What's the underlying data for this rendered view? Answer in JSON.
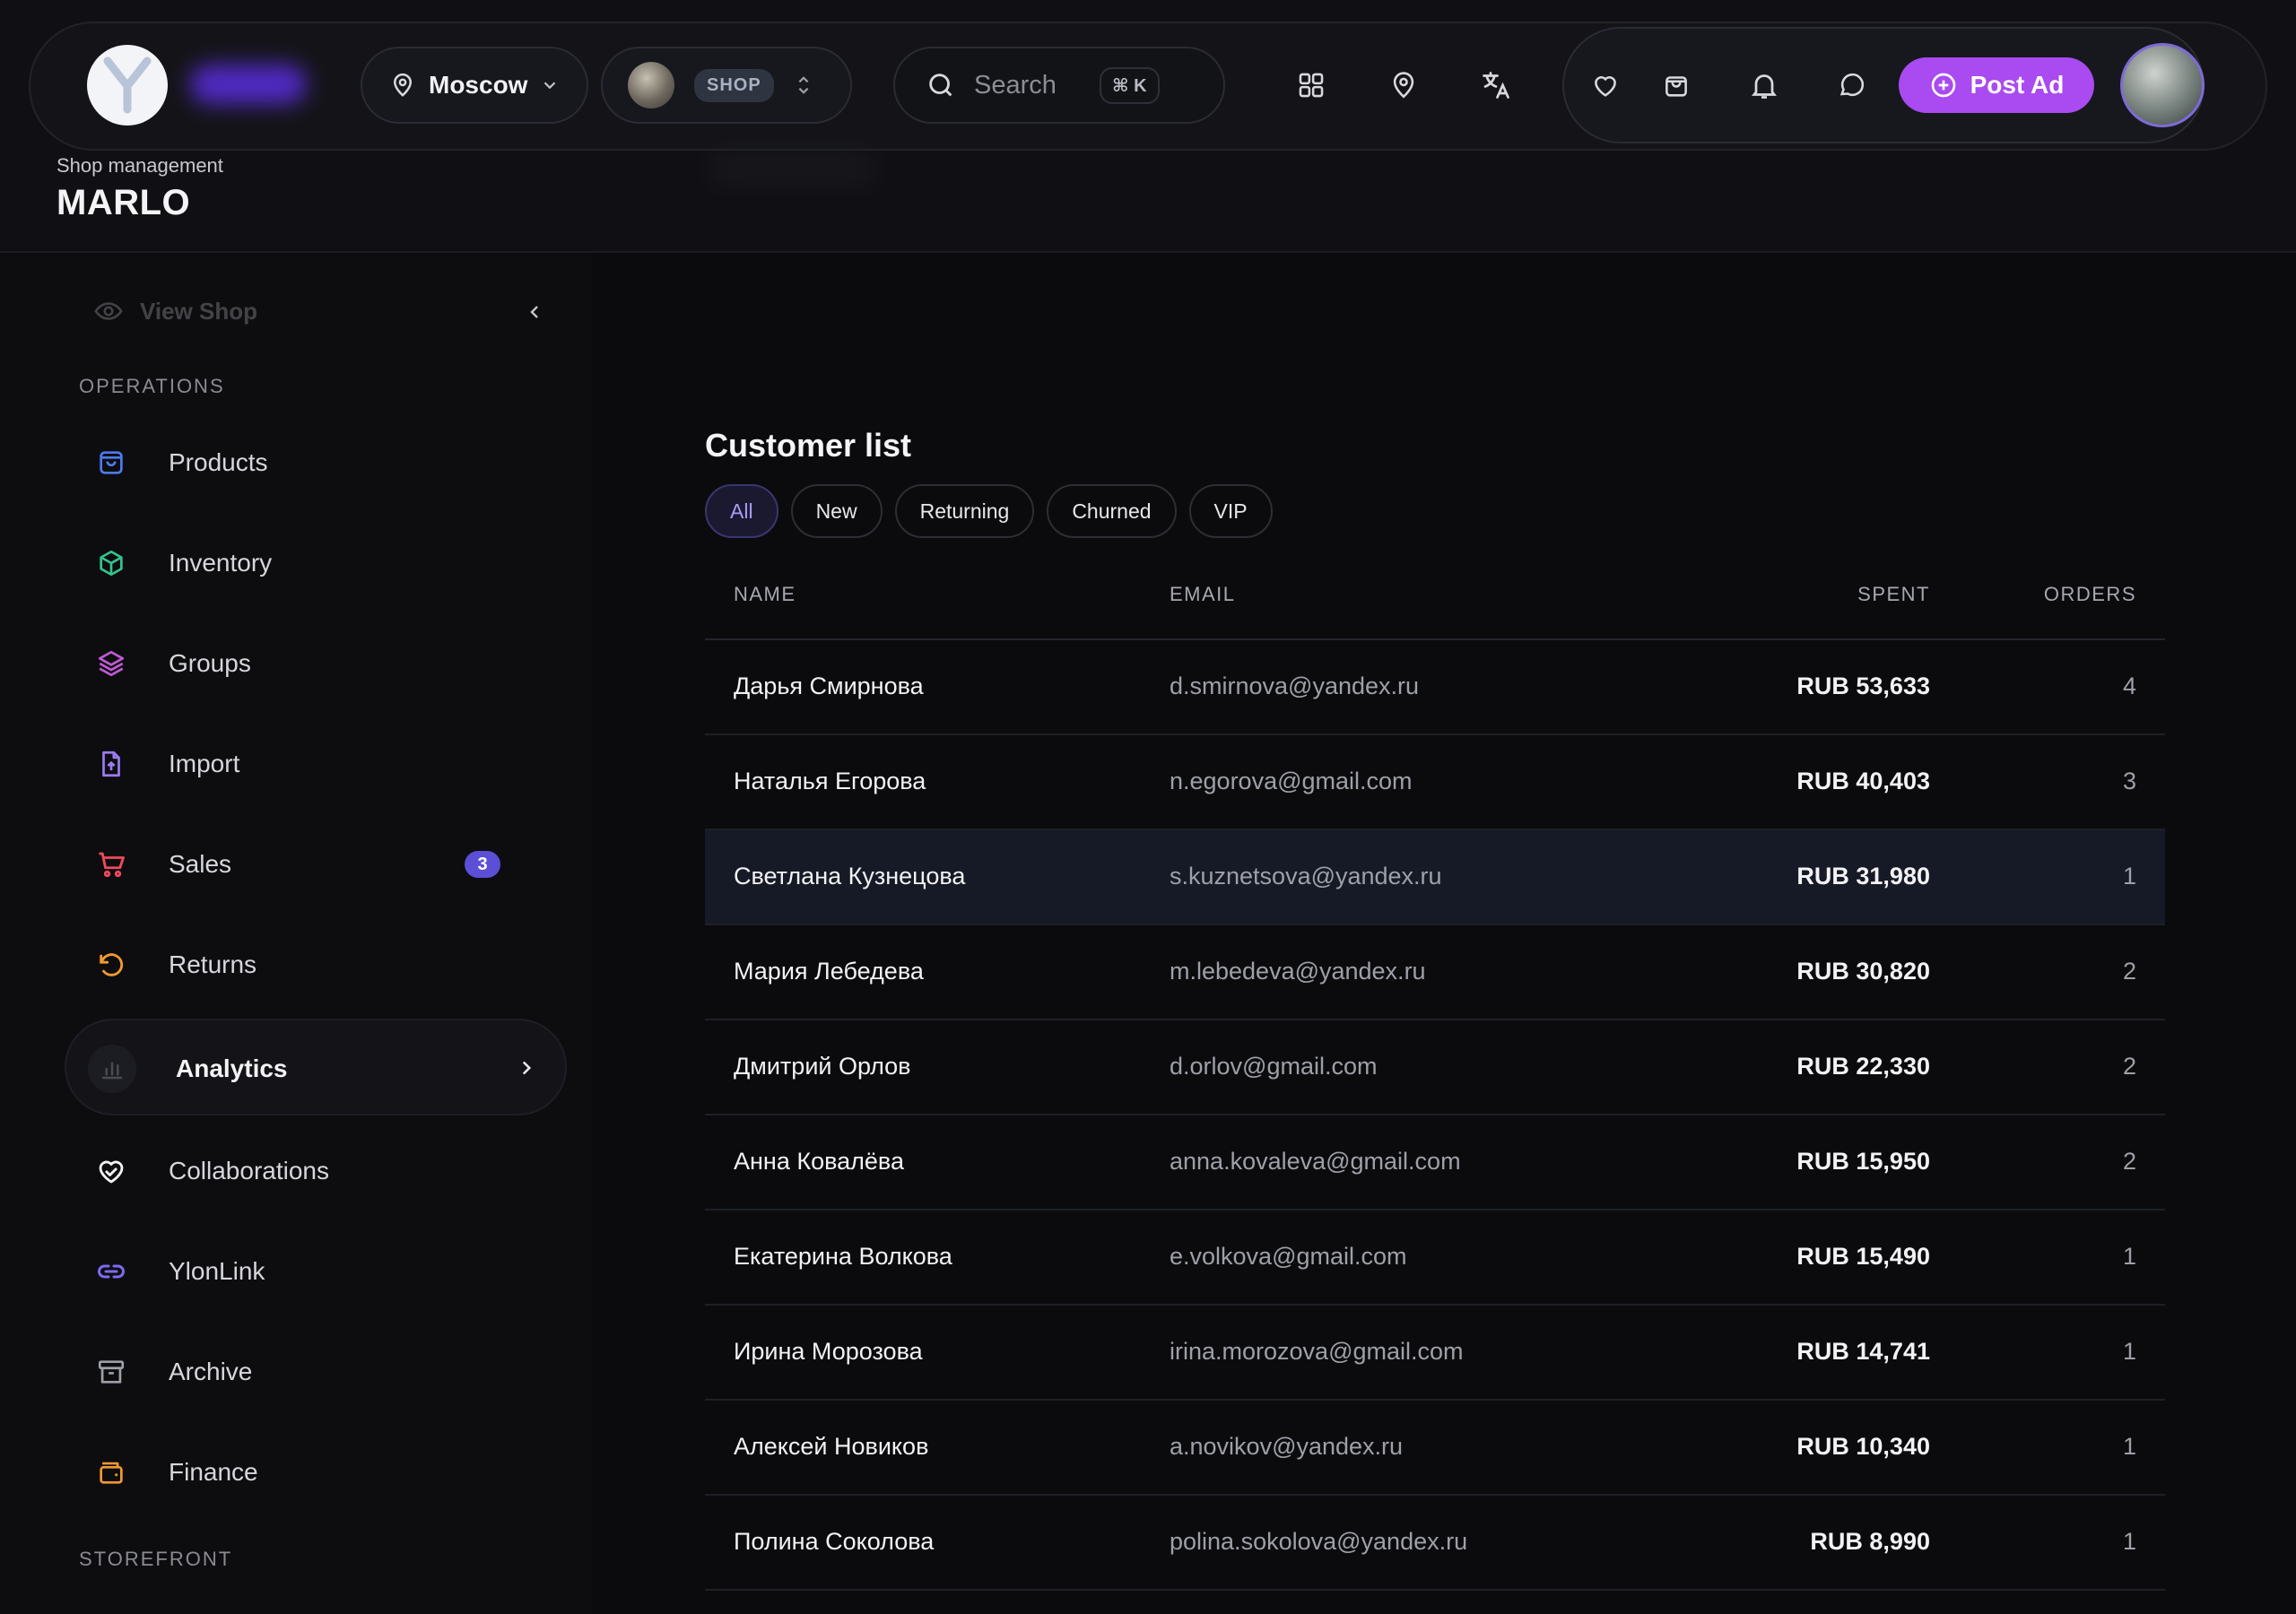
{
  "header": {
    "location": "Moscow",
    "shop_badge": "SHOP",
    "search_placeholder": "Search",
    "search_shortcut": "⌘ K",
    "post_ad_label": "Post Ad",
    "breadcrumb_label": "Shop management",
    "shop_name": "MARLO"
  },
  "sidebar": {
    "view_shop": "View Shop",
    "sections": {
      "operations": "OPERATIONS",
      "storefront": "STOREFRONT"
    },
    "items": [
      {
        "label": "Products",
        "icon": "bag-icon"
      },
      {
        "label": "Inventory",
        "icon": "box-icon"
      },
      {
        "label": "Groups",
        "icon": "layers-icon"
      },
      {
        "label": "Import",
        "icon": "file-upload-icon"
      },
      {
        "label": "Sales",
        "icon": "cart-icon",
        "badge": "3"
      },
      {
        "label": "Returns",
        "icon": "rotate-icon"
      },
      {
        "label": "Analytics",
        "icon": "bar-chart-icon",
        "active": true
      },
      {
        "label": "Collaborations",
        "icon": "handshake-heart-icon"
      },
      {
        "label": "YlonLink",
        "icon": "link-icon"
      },
      {
        "label": "Archive",
        "icon": "archive-icon"
      },
      {
        "label": "Finance",
        "icon": "wallet-icon"
      }
    ]
  },
  "main": {
    "title": "Customer list",
    "filters": [
      "All",
      "New",
      "Returning",
      "Churned",
      "VIP"
    ],
    "active_filter": "All",
    "columns": {
      "name": "NAME",
      "email": "EMAIL",
      "spent": "SPENT",
      "orders": "ORDERS"
    },
    "rows": [
      {
        "name": "Дарья Смирнова",
        "email": "d.smirnova@yandex.ru",
        "spent": "RUB 53,633",
        "orders": "4"
      },
      {
        "name": "Наталья Егорова",
        "email": "n.egorova@gmail.com",
        "spent": "RUB 40,403",
        "orders": "3"
      },
      {
        "name": "Светлана Кузнецова",
        "email": "s.kuznetsova@yandex.ru",
        "spent": "RUB 31,980",
        "orders": "1"
      },
      {
        "name": "Мария Лебедева",
        "email": "m.lebedeva@yandex.ru",
        "spent": "RUB 30,820",
        "orders": "2"
      },
      {
        "name": "Дмитрий Орлов",
        "email": "d.orlov@gmail.com",
        "spent": "RUB 22,330",
        "orders": "2"
      },
      {
        "name": "Анна Ковалёва",
        "email": "anna.kovaleva@gmail.com",
        "spent": "RUB 15,950",
        "orders": "2"
      },
      {
        "name": "Екатерина Волкова",
        "email": "e.volkova@gmail.com",
        "spent": "RUB 15,490",
        "orders": "1"
      },
      {
        "name": "Ирина Морозова",
        "email": "irina.morozova@gmail.com",
        "spent": "RUB 14,741",
        "orders": "1"
      },
      {
        "name": "Алексей Новиков",
        "email": "a.novikov@yandex.ru",
        "spent": "RUB 10,340",
        "orders": "1"
      },
      {
        "name": "Полина Соколова",
        "email": "polina.sokolova@yandex.ru",
        "spent": "RUB 8,990",
        "orders": "1"
      }
    ]
  },
  "colors": {
    "accent": "#a94bf0",
    "badge": "#5b4fd6",
    "active_chip_text": "#a99cf2"
  }
}
